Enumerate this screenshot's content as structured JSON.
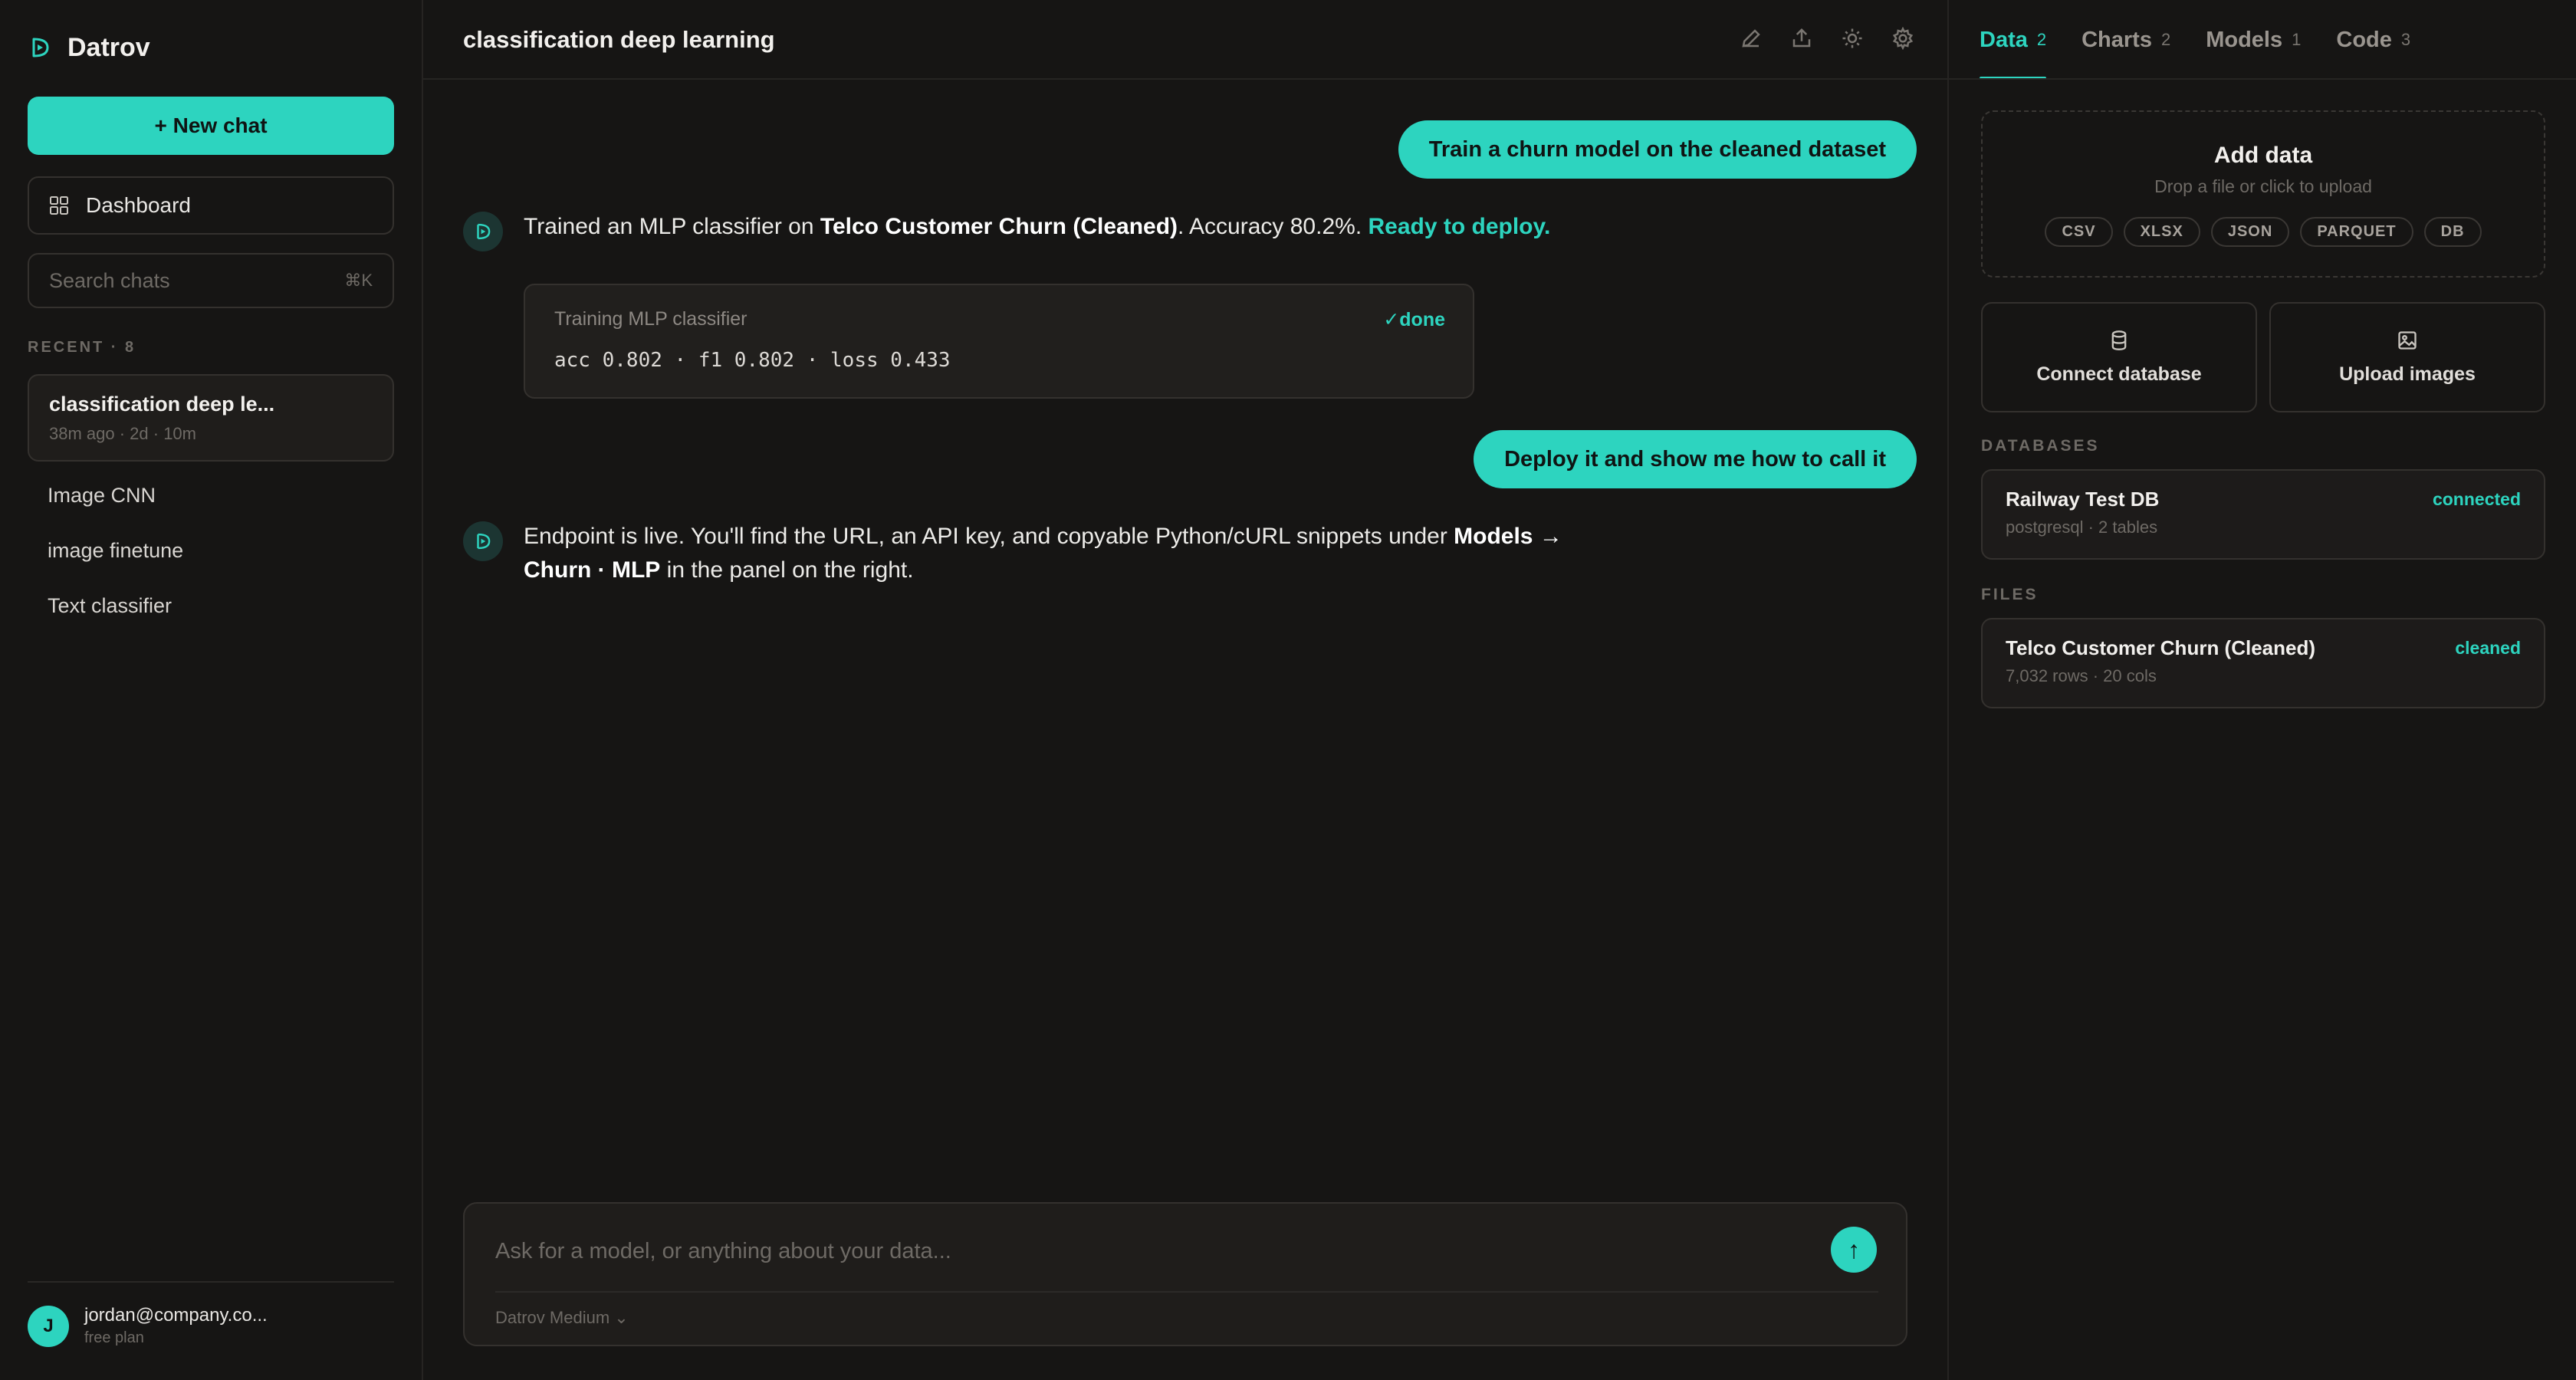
{
  "sidebar": {
    "brand": "Datrov",
    "new_chat": "+ New chat",
    "dashboard": "Dashboard",
    "search_placeholder": "Search chats",
    "search_shortcut": "⌘K",
    "recent_header": "RECENT · 8",
    "active_chat": {
      "title": "classification deep le...",
      "meta": "38m ago · 2d · 10m"
    },
    "chats": [
      "Image CNN",
      "image finetune",
      "Text classifier"
    ],
    "user": {
      "initial": "J",
      "email": "jordan@company.co...",
      "plan": "free plan"
    }
  },
  "main": {
    "title": "classification deep learning",
    "header_icons": [
      "edit-icon",
      "share-icon",
      "theme-icon",
      "settings-icon"
    ],
    "messages": {
      "user_1": "Train a churn model on the cleaned dataset",
      "bot_1": {
        "prefix": "Trained an MLP classifier on ",
        "dataset": "Telco Customer Churn (Cleaned)",
        "middle": ". Accuracy 80.2%. ",
        "status": "Ready to deploy."
      },
      "training": {
        "label": "Training MLP classifier",
        "status": "✓done",
        "metrics": "acc 0.802 · f1 0.802 · loss 0.433"
      },
      "user_2": "Deploy it and show me how to call it",
      "bot_2": {
        "prefix": "Endpoint is live. You'll find the URL, an API key, and copyable Python/cURL snippets under ",
        "models": "Models →",
        "target": "Churn · MLP",
        "suffix": " in the panel on the right."
      }
    },
    "composer": {
      "placeholder": "Ask for a model, or anything about your data...",
      "send": "↑",
      "model": "Datrov Medium ⌄"
    }
  },
  "panel": {
    "tabs": [
      {
        "label": "Data",
        "count": "2"
      },
      {
        "label": "Charts",
        "count": "2"
      },
      {
        "label": "Models",
        "count": "1"
      },
      {
        "label": "Code",
        "count": "3"
      }
    ],
    "add_data": {
      "title": "Add data",
      "subtitle": "Drop a file or click to upload",
      "formats": [
        "CSV",
        "XLSX",
        "JSON",
        "PARQUET",
        "DB"
      ]
    },
    "actions": {
      "connect": "Connect database",
      "upload": "Upload images"
    },
    "databases_header": "DATABASES",
    "database": {
      "name": "Railway Test DB",
      "detail": "postgresql · 2 tables",
      "status": "connected"
    },
    "files_header": "FILES",
    "file": {
      "name": "Telco Customer Churn (Cleaned)",
      "detail": "7,032 rows · 20 cols",
      "status": "cleaned"
    }
  },
  "colors": {
    "accent": "#2dd4bf",
    "background": "#161514"
  }
}
